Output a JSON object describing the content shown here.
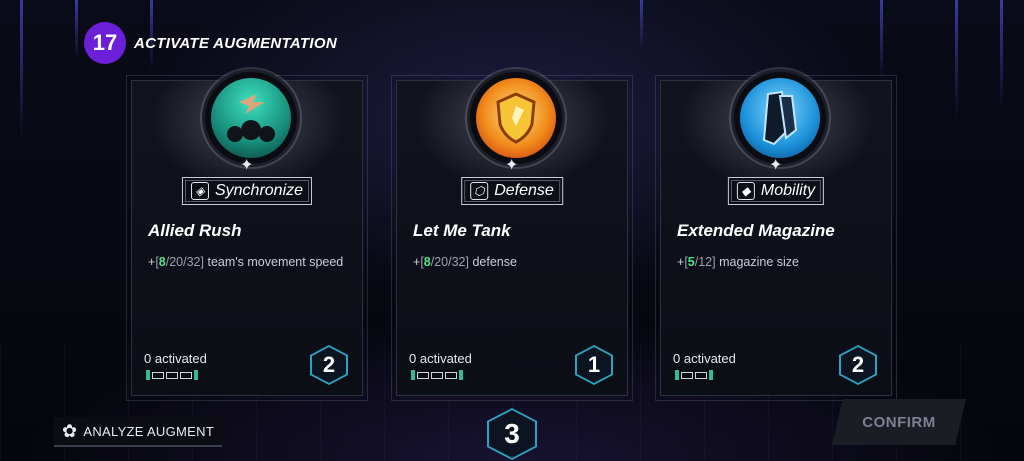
{
  "header": {
    "round_number": "17",
    "title": "ACTIVATE AUGMENTATION"
  },
  "cards": [
    {
      "icon": "allied-rush-icon",
      "category": "Synchronize",
      "category_icon": "synchronize-icon",
      "name": "Allied Rush",
      "desc_prefix": "+",
      "desc_open": "[",
      "desc_highlight": "8",
      "desc_rest": "/20/32",
      "desc_close": "]",
      "desc_suffix": " team's movement speed",
      "activated": "0 activated",
      "slots": 3,
      "cost": "2"
    },
    {
      "icon": "let-me-tank-icon",
      "category": "Defense",
      "category_icon": "defense-icon",
      "name": "Let Me Tank",
      "desc_prefix": "+",
      "desc_open": "[",
      "desc_highlight": "8",
      "desc_rest": "/20/32",
      "desc_close": "]",
      "desc_suffix": " defense",
      "activated": "0 activated",
      "slots": 3,
      "cost": "1"
    },
    {
      "icon": "extended-magazine-icon",
      "category": "Mobility",
      "category_icon": "mobility-icon",
      "name": "Extended Magazine",
      "desc_prefix": "+",
      "desc_open": "[",
      "desc_highlight": "5",
      "desc_rest": "/12",
      "desc_close": "]",
      "desc_suffix": " magazine size",
      "activated": "0 activated",
      "slots": 2,
      "cost": "2"
    }
  ],
  "footer": {
    "analyze_label": "ANALYZE AUGMENT",
    "points": "3",
    "confirm_label": "CONFIRM"
  },
  "colors": {
    "accent_purple": "#6b1fd6",
    "highlight_green": "#4fe38a",
    "hex_cyan": "#2aa4c2"
  }
}
